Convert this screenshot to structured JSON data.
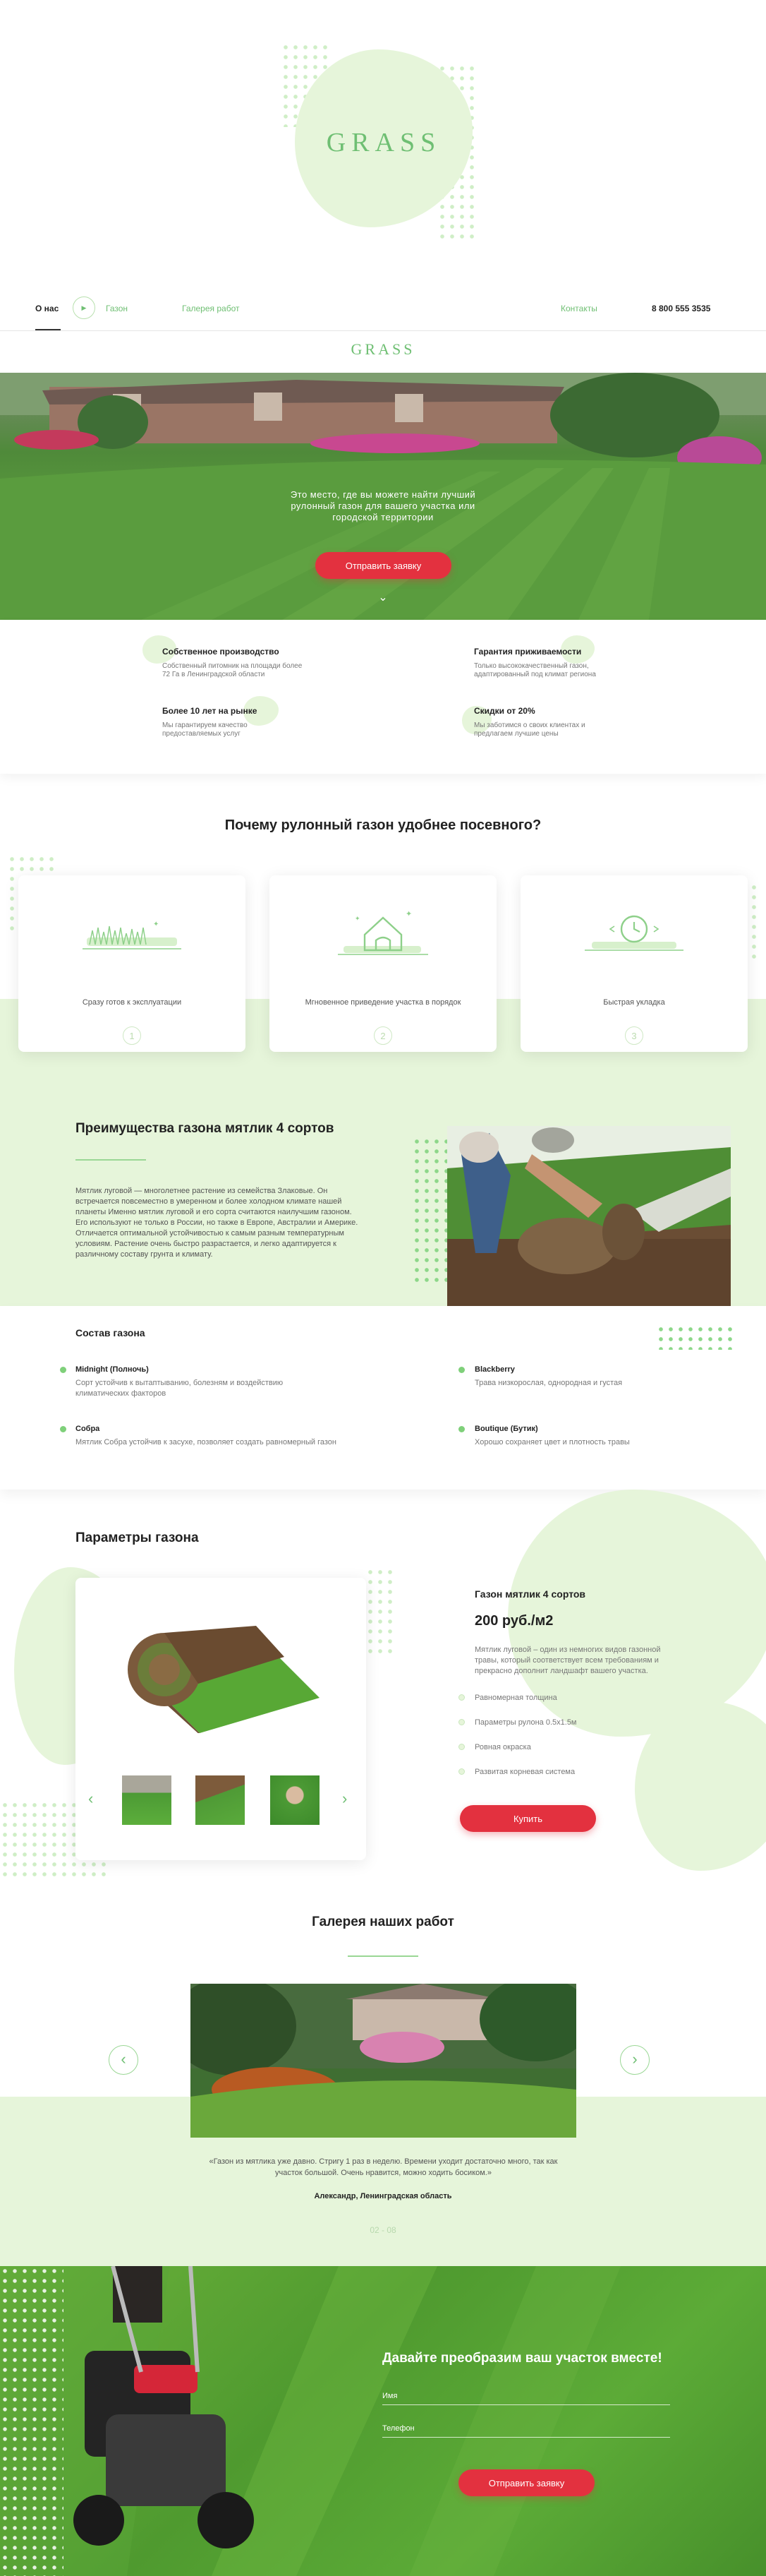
{
  "logo": "GRASS",
  "nav": {
    "about": "О нас",
    "lawn": "Газон",
    "gallery": "Галерея работ",
    "contacts": "Контакты",
    "phone": "8 800 555 3535"
  },
  "hero": {
    "headline": "Это место, где вы можете найти лучший рулонный газон для вашего участка или городской территории",
    "cta": "Отправить заявку"
  },
  "features": [
    {
      "title": "Собственное производство",
      "text": "Собственный питомник на площади более 72 Га в Ленинградской области"
    },
    {
      "title": "Гарантия приживаемости",
      "text": "Только высококачественный газон, адаптированный под климат региона"
    },
    {
      "title": "Более 10 лет на рынке",
      "text": "Мы гарантируем качество предоставляемых услуг"
    },
    {
      "title": "Скидки от 20%",
      "text": "Мы заботимся о своих клиентах и предлагаем лучшие цены"
    }
  ],
  "why": {
    "title": "Почему рулонный газон удобнее посевного?",
    "cards": [
      "Сразу готов к эксплуатации",
      "Мгновенное приведение участка в порядок",
      "Быстрая укладка"
    ],
    "card_numbers": [
      "1",
      "2",
      "3"
    ]
  },
  "advantages": {
    "title": "Преимущества газона мятлик 4 сортов",
    "text": "Мятлик луговой — многолетнее растение из семейства Злаковые. Он встречается повсеместно в умеренном и более холодном климате нашей планеты Именно мятлик луговой и его сорта считаются наилучшим газоном. Его используют не только в России, но также в Европе, Австралии и Америке. Отличается оптимальной устойчивостью к самым разным температурным условиям. Растение очень быстро разрастается, и легко адаптируется к различному составу грунта и климату."
  },
  "composition": {
    "title": "Состав газона",
    "items": [
      {
        "name": "Midnight (Полночь)",
        "desc": "Сорт устойчив к вытаптыванию, болезням и воздействию климатических факторов"
      },
      {
        "name": "Blackberry",
        "desc": "Трава низкорослая, однородная и густая"
      },
      {
        "name": "Cобра",
        "desc": "Мятлик Cобра устойчив к засухе, позволяет создать равномерный газон"
      },
      {
        "name": "Boutique (Бутик)",
        "desc": "Хорошо сохраняет цвет и плотность травы"
      }
    ]
  },
  "params": {
    "title": "Параметры газона",
    "product": "Газон мятлик 4 сортов",
    "price": "200 руб./м2",
    "desc": "Мятлик луговой – один из немногих видов газонной травы, который соответствует всем требованиям и прекрасно дополнит ландшафт вашего участка.",
    "list": [
      "Равномерная толщина",
      "Параметры рулона 0.5х1.5м",
      "Ровная окраска",
      "Развитая корневая система"
    ],
    "buy": "Купить",
    "prev": "‹",
    "next": "›"
  },
  "gallery": {
    "title": "Галерея наших работ",
    "quote": "«Газон из мятлика уже давно. Стригу 1 раз в неделю. Времени уходит достаточно много, так как участок большой. Очень нравится, можно ходить босиком.»",
    "author": "Александр, Ленинградская область",
    "counter": "02 - 08",
    "prev": "‹",
    "next": "›"
  },
  "contact": {
    "title": "Давайте преобразим ваш участок вместе!",
    "name_label": "Имя",
    "phone_label": "Телефон",
    "submit": "Отправить заявку"
  },
  "colors": {
    "accent_green": "#6fbf73",
    "light_green": "#e6f5da",
    "cta_red": "#e3313f"
  }
}
